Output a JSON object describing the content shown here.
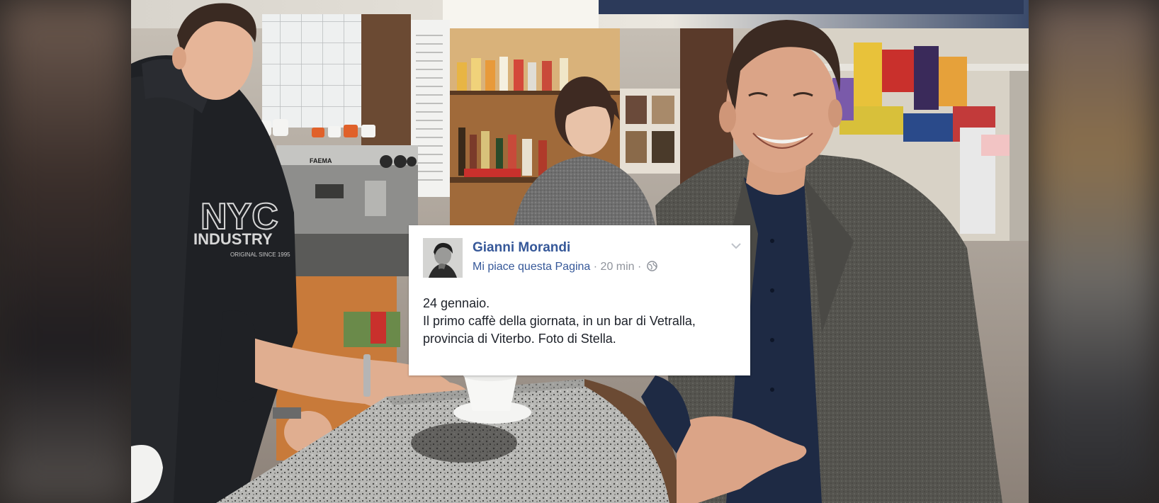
{
  "post": {
    "author": "Gianni Morandi",
    "page_action": "Mi piace questa Pagina",
    "separator_1": " · ",
    "time": "20 min",
    "separator_2": " · ",
    "privacy_icon": "globe-icon",
    "menu_icon": "chevron-down-icon",
    "lines": [
      "24 gennaio.",
      "Il primo caffè della giornata, in un bar di Vetralla,",
      "provincia di Viterbo. Foto di Stella."
    ]
  },
  "photo": {
    "sweater_text_1": "NYC",
    "sweater_text_2": "INDUSTRY",
    "sweater_text_3": "ORIGINAL SINCE 1995",
    "machine_brand": "FAEMA"
  },
  "colors": {
    "link": "#365899",
    "meta": "#90949c",
    "text": "#1d2129",
    "card_bg": "#ffffff"
  }
}
